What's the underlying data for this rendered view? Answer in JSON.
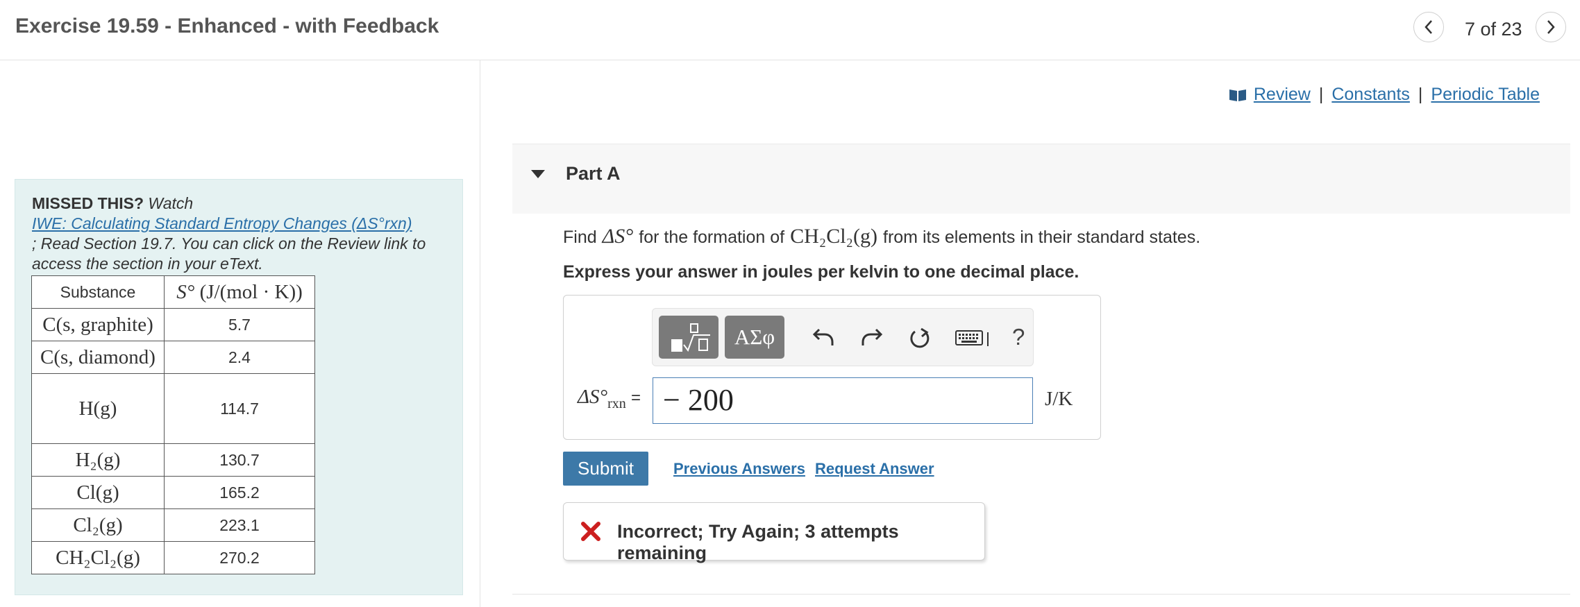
{
  "header": {
    "title": "Exercise 19.59 - Enhanced - with Feedback",
    "counter": "7 of 23"
  },
  "missed": {
    "label": "MISSED THIS?",
    "watch": "Watch",
    "link_text": "IWE: Calculating Standard Entropy Changes (ΔS°rxn)",
    "rest": "; Read Section 19.7. You can click on the Review link to access the section in your eText."
  },
  "table": {
    "header_substance": "Substance",
    "header_s_symbol": "S°",
    "header_s_units": "(J/(mol · K))",
    "rows": [
      {
        "substance": "C(s, graphite)",
        "value": "5.7"
      },
      {
        "substance": "C(s, diamond)",
        "value": "2.4"
      },
      {
        "substance": "H(g)",
        "value": "114.7"
      },
      {
        "substance": "H₂(g)",
        "value": "130.7"
      },
      {
        "substance": "Cl(g)",
        "value": "165.2"
      },
      {
        "substance": "Cl₂(g)",
        "value": "223.1"
      },
      {
        "substance": "CH₂Cl₂(g)",
        "value": "270.2"
      }
    ]
  },
  "links": {
    "review": "Review",
    "separator": "|",
    "constants": "Constants",
    "periodic_table": "Periodic Table"
  },
  "part": {
    "title": "Part A"
  },
  "question": {
    "find": "Find",
    "delta_s": "ΔS°",
    "middle": "for the formation of",
    "compound": "CH₂Cl₂(g)",
    "end": "from its elements in their standard states.",
    "instruction": "Express your answer in joules per kelvin to one decimal place."
  },
  "toolbar": {
    "symbols_label": "ΑΣφ",
    "help_label": "?"
  },
  "answer": {
    "delta_label": "ΔS°",
    "delta_sub": "rxn",
    "equals": "=",
    "value": "− 200",
    "unit": "J/K"
  },
  "actions": {
    "submit": "Submit",
    "previous_answers": "Previous Answers",
    "request_answer": "Request Answer"
  },
  "feedback": {
    "text": "Incorrect; Try Again; 3 attempts remaining",
    "icon_color": "#cc1f1f"
  },
  "colors": {
    "link": "#2a6fa8",
    "submit_bg": "#3d79a8",
    "panel_bg": "#e5f2f2"
  }
}
